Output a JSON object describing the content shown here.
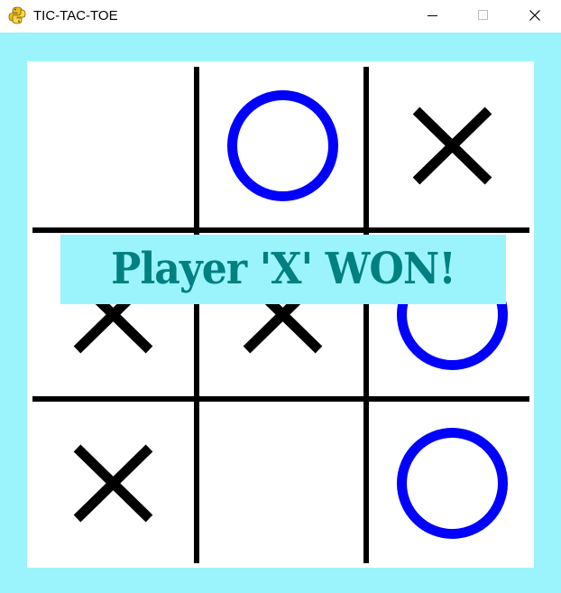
{
  "window": {
    "title": "TIC-TAC-TOE"
  },
  "icons": {
    "app": "python-snake-icon",
    "minimize": "minimize-icon",
    "maximize": "maximize-icon",
    "close": "close-icon"
  },
  "colors": {
    "background": "#9bf4fb",
    "board": "#ffffff",
    "grid": "#000000",
    "x_mark": "#000000",
    "o_mark": "#0000ff",
    "banner_bg": "#9bf4fb",
    "banner_text": "#008080"
  },
  "board": {
    "cells": [
      [
        "",
        "O",
        "X"
      ],
      [
        "X",
        "X",
        "O"
      ],
      [
        "X",
        "",
        "O"
      ]
    ]
  },
  "status": {
    "message": "Player 'X' WON!"
  }
}
